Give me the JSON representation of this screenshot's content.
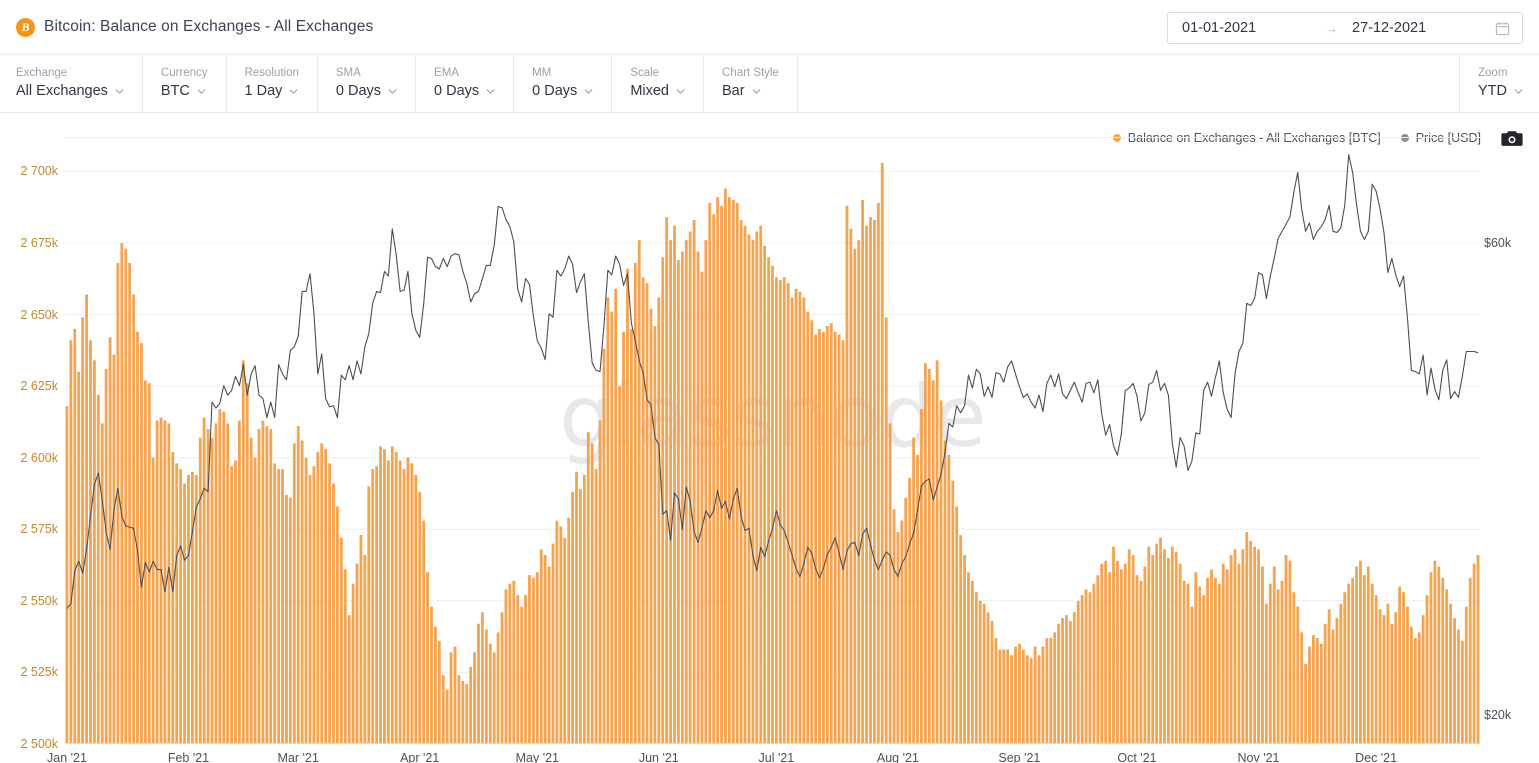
{
  "header": {
    "icon": "bitcoin-icon",
    "icon_glyph": "B",
    "title": "Bitcoin: Balance on Exchanges - All Exchanges",
    "date_start": "01-01-2021",
    "date_end": "27-12-2021",
    "date_arrow": "→",
    "calendar_icon": "calendar-icon"
  },
  "toolbar": {
    "controls": [
      {
        "label": "Exchange",
        "value": "All Exchanges"
      },
      {
        "label": "Currency",
        "value": "BTC"
      },
      {
        "label": "Resolution",
        "value": "1 Day"
      },
      {
        "label": "SMA",
        "value": "0 Days"
      },
      {
        "label": "EMA",
        "value": "0 Days"
      },
      {
        "label": "MM",
        "value": "0 Days"
      },
      {
        "label": "Scale",
        "value": "Mixed"
      },
      {
        "label": "Chart Style",
        "value": "Bar"
      }
    ],
    "zoom": {
      "label": "Zoom",
      "value": "YTD"
    }
  },
  "legend": {
    "items": [
      {
        "label": "Balance on Exchanges - All Exchanges [BTC]",
        "color": "#f4a44e",
        "icon": "legend-dot"
      },
      {
        "label": "Price [USD]",
        "color": "#8a8f98",
        "icon": "legend-dot"
      }
    ],
    "camera_icon": "camera-icon"
  },
  "watermark": "glassnode",
  "colors": {
    "bar": "#f4a44e",
    "price_line": "#4a4f57",
    "left_axis_text": "#c08a2e",
    "right_axis_text": "#4a505b",
    "grid": "#eceef1",
    "accent": "#f7931a"
  },
  "chart_data": {
    "type": "bar",
    "title": "Bitcoin: Balance on Exchanges - All Exchanges",
    "xlabel": "",
    "ylabel": "Balance on Exchanges - All Exchanges [BTC]",
    "y2label": "Price [USD]",
    "grid": true,
    "legend_position": "top-right",
    "xlim": [
      "2021-01-01",
      "2021-12-27"
    ],
    "ylim": [
      2500000,
      2712000
    ],
    "y2lim": [
      17500,
      69000
    ],
    "yticks": [
      2500000,
      2525000,
      2550000,
      2575000,
      2600000,
      2625000,
      2650000,
      2675000,
      2700000
    ],
    "ytick_labels": [
      "2 500k",
      "2 525k",
      "2 550k",
      "2 575k",
      "2 600k",
      "2 625k",
      "2 650k",
      "2 675k",
      "2 700k"
    ],
    "y2ticks": [
      20000,
      60000
    ],
    "y2tick_labels": [
      "$20k",
      "$60k"
    ],
    "xtick_labels": [
      "Jan '21",
      "Feb '21",
      "Mar '21",
      "Apr '21",
      "May '21",
      "Jun '21",
      "Jul '21",
      "Aug '21",
      "Sep '21",
      "Oct '21",
      "Nov '21",
      "Dec '21"
    ],
    "xtick_positions": [
      0,
      31,
      59,
      90,
      120,
      151,
      181,
      212,
      243,
      273,
      304,
      334
    ],
    "n_points": 361,
    "series": [
      {
        "name": "Balance on Exchanges - All Exchanges [BTC]",
        "type": "bar",
        "axis": "left",
        "color": "#f4a44e",
        "unit": "BTC",
        "values": [
          2618000,
          2641000,
          2645000,
          2630000,
          2649000,
          2657000,
          2641000,
          2634000,
          2622000,
          2612000,
          2631000,
          2642000,
          2636000,
          2668000,
          2675000,
          2673000,
          2668000,
          2657000,
          2644000,
          2640000,
          2627000,
          2626000,
          2600000,
          2613000,
          2614000,
          2613000,
          2612000,
          2602000,
          2598000,
          2596000,
          2591000,
          2594000,
          2595000,
          2594000,
          2607000,
          2614000,
          2610000,
          2607000,
          2612000,
          2617000,
          2616000,
          2612000,
          2597000,
          2599000,
          2613000,
          2634000,
          2626000,
          2607000,
          2600000,
          2610000,
          2613000,
          2611000,
          2610000,
          2598000,
          2596000,
          2596000,
          2587000,
          2586000,
          2605000,
          2611000,
          2606000,
          2600000,
          2594000,
          2597000,
          2602000,
          2605000,
          2603000,
          2598000,
          2591000,
          2583000,
          2572000,
          2561000,
          2545000,
          2556000,
          2563000,
          2573000,
          2566000,
          2590000,
          2596000,
          2597000,
          2604000,
          2603000,
          2599000,
          2604000,
          2602000,
          2599000,
          2596000,
          2600000,
          2598000,
          2594000,
          2588000,
          2578000,
          2560000,
          2548000,
          2541000,
          2536000,
          2524000,
          2519000,
          2532000,
          2534000,
          2524000,
          2522000,
          2521000,
          2527000,
          2532000,
          2542000,
          2546000,
          2540000,
          2535000,
          2532000,
          2539000,
          2546000,
          2554000,
          2556000,
          2557000,
          2552000,
          2548000,
          2552000,
          2559000,
          2558000,
          2560000,
          2568000,
          2566000,
          2562000,
          2570000,
          2578000,
          2576000,
          2572000,
          2579000,
          2588000,
          2595000,
          2589000,
          2594000,
          2609000,
          2605000,
          2596000,
          2613000,
          2638000,
          2656000,
          2651000,
          2659000,
          2625000,
          2644000,
          2666000,
          2645000,
          2668000,
          2676000,
          2663000,
          2661000,
          2652000,
          2646000,
          2656000,
          2670000,
          2684000,
          2676000,
          2681000,
          2669000,
          2672000,
          2676000,
          2679000,
          2683000,
          2672000,
          2665000,
          2676000,
          2689000,
          2685000,
          2691000,
          2688000,
          2694000,
          2691000,
          2690000,
          2689000,
          2683000,
          2681000,
          2678000,
          2676000,
          2679000,
          2681000,
          2674000,
          2670000,
          2667000,
          2663000,
          2662000,
          2663000,
          2661000,
          2656000,
          2659000,
          2658000,
          2656000,
          2651000,
          2648000,
          2643000,
          2645000,
          2644000,
          2646000,
          2647000,
          2644000,
          2643000,
          2641000,
          2688000,
          2680000,
          2673000,
          2676000,
          2690000,
          2681000,
          2684000,
          2683000,
          2689000,
          2703000,
          2649000,
          2612000,
          2582000,
          2574000,
          2578000,
          2586000,
          2593000,
          2607000,
          2601000,
          2617000,
          2633000,
          2631000,
          2627000,
          2634000,
          2620000,
          2606000,
          2601000,
          2592000,
          2583000,
          2573000,
          2566000,
          2560000,
          2557000,
          2553000,
          2550000,
          2549000,
          2546000,
          2543000,
          2537000,
          2533000,
          2533000,
          2533000,
          2531000,
          2534000,
          2535000,
          2533000,
          2531000,
          2530000,
          2534000,
          2531000,
          2534000,
          2537000,
          2537000,
          2539000,
          2542000,
          2544000,
          2545000,
          2543000,
          2546000,
          2550000,
          2552000,
          2554000,
          2553000,
          2556000,
          2559000,
          2563000,
          2564000,
          2560000,
          2569000,
          2564000,
          2561000,
          2563000,
          2568000,
          2566000,
          2559000,
          2557000,
          2562000,
          2569000,
          2566000,
          2570000,
          2572000,
          2568000,
          2565000,
          2569000,
          2567000,
          2563000,
          2557000,
          2556000,
          2548000,
          2560000,
          2555000,
          2552000,
          2558000,
          2561000,
          2558000,
          2556000,
          2563000,
          2561000,
          2566000,
          2568000,
          2563000,
          2568000,
          2574000,
          2571000,
          2569000,
          2568000,
          2562000,
          2549000,
          2556000,
          2562000,
          2554000,
          2557000,
          2566000,
          2564000,
          2553000,
          2548000,
          2539000,
          2528000,
          2534000,
          2538000,
          2537000,
          2535000,
          2542000,
          2547000,
          2540000,
          2544000,
          2549000,
          2553000,
          2556000,
          2558000,
          2562000,
          2564000,
          2559000,
          2562000,
          2556000,
          2552000,
          2547000,
          2545000,
          2549000,
          2542000,
          2546000,
          2555000,
          2553000,
          2548000,
          2541000,
          2537000,
          2539000,
          2545000,
          2552000,
          2560000,
          2564000,
          2562000,
          2558000,
          2554000,
          2549000,
          2544000,
          2540000,
          2536000,
          2548000,
          2558000,
          2563000,
          2566000
        ]
      },
      {
        "name": "Price [USD]",
        "type": "line",
        "axis": "right",
        "color": "#4a4f57",
        "unit": "USD",
        "values": [
          29000,
          29400,
          32200,
          33000,
          32000,
          34000,
          36800,
          39500,
          40500,
          38200,
          35500,
          34000,
          37400,
          39200,
          36800,
          36000,
          35900,
          35800,
          33900,
          30800,
          32900,
          32100,
          33000,
          32300,
          32300,
          30400,
          32500,
          30400,
          33500,
          34300,
          33100,
          33500,
          35500,
          37600,
          38300,
          39200,
          38900,
          46500,
          46000,
          46400,
          47900,
          47100,
          47500,
          48700,
          47900,
          49700,
          47100,
          48900,
          49600,
          47100,
          46800,
          45200,
          46500,
          45200,
          49700,
          48900,
          48400,
          50900,
          51200,
          52100,
          55900,
          55900,
          57400,
          54100,
          48900,
          50600,
          46800,
          46100,
          46200,
          45200,
          48800,
          48400,
          49600,
          48400,
          50000,
          48900,
          51200,
          52300,
          54900,
          55900,
          55800,
          57600,
          57200,
          61200,
          59000,
          55900,
          56000,
          57600,
          54000,
          52600,
          52000,
          54800,
          58800,
          58700,
          58000,
          57800,
          58700,
          58000,
          58900,
          59100,
          59000,
          57600,
          56600,
          55000,
          55700,
          55900,
          57000,
          58100,
          58100,
          59800,
          63100,
          63000,
          62000,
          61400,
          60100,
          56100,
          55000,
          57000,
          56500,
          53800,
          51700,
          51100,
          50100,
          54000,
          53700,
          57700,
          57200,
          57800,
          58900,
          58200,
          55800,
          56700,
          57400,
          53300,
          49800,
          49200,
          49100,
          53000,
          57700,
          57300,
          58900,
          58200,
          56400,
          57400,
          53200,
          51700,
          50000,
          49000,
          46700,
          46300,
          43500,
          42900,
          37000,
          37300,
          34800,
          38800,
          38300,
          35700,
          39300,
          38100,
          35500,
          34600,
          35800,
          37300,
          36700,
          37300,
          39000,
          37500,
          38100,
          36600,
          38300,
          39200,
          36800,
          35600,
          35800,
          33500,
          32200,
          34200,
          33400,
          34700,
          35800,
          37300,
          36100,
          35600,
          34600,
          33500,
          32400,
          31700,
          32800,
          34200,
          33700,
          32400,
          31600,
          32400,
          33600,
          34200,
          35000,
          33700,
          32300,
          33900,
          34500,
          34600,
          33500,
          35300,
          35800,
          34400,
          33100,
          32300,
          33100,
          33800,
          33500,
          32300,
          31700,
          32800,
          33400,
          34500,
          35400,
          37300,
          39400,
          39800,
          40000,
          38200,
          39300,
          40400,
          42200,
          44700,
          44400,
          46200,
          45600,
          46200,
          48800,
          47700,
          49300,
          48900,
          47000,
          47800,
          46900,
          49000,
          48900,
          48200,
          49500,
          50000,
          48900,
          47800,
          46900,
          47200,
          46500,
          46000,
          47100,
          45700,
          48100,
          48800,
          47800,
          48900,
          47200,
          46800,
          47500,
          48200,
          47300,
          46500,
          48100,
          48200,
          47300,
          48400,
          45500,
          43700,
          44600,
          42800,
          42000,
          43800,
          47500,
          47700,
          48100,
          47000,
          44900,
          45600,
          48000,
          48200,
          49200,
          47500,
          48100,
          47100,
          43000,
          41000,
          43500,
          42800,
          40700,
          41500,
          43900,
          43800,
          47500,
          48200,
          47000,
          48600,
          50000,
          47300,
          45900,
          45200,
          48900,
          50800,
          51500,
          54900,
          54700,
          55300,
          57500,
          57300,
          55300,
          57200,
          58700,
          60400,
          61000,
          61600,
          62200,
          64300,
          66000,
          62900,
          61000,
          61700,
          60300,
          61000,
          61400,
          62000,
          63200,
          61000,
          60900,
          61300,
          63200,
          67500,
          66000,
          63300,
          61000,
          60300,
          61000,
          65000,
          64400,
          62900,
          60900,
          57500,
          58700,
          57300,
          56300,
          57200,
          53600,
          49200,
          49100,
          48900,
          50500,
          47100,
          49400,
          47600,
          46700,
          49200,
          50100,
          46800,
          47400,
          46900,
          48700,
          50800,
          50800,
          50800,
          50700
        ]
      }
    ]
  }
}
